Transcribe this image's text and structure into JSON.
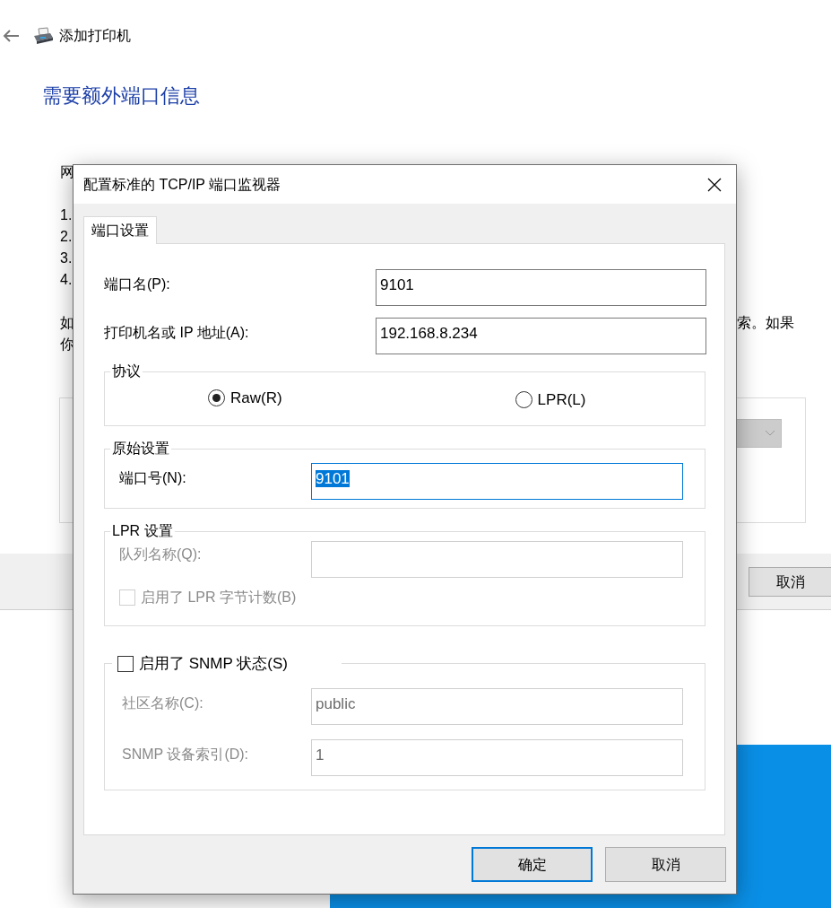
{
  "wizard": {
    "title": "添加打印机",
    "heading": "需要额外端口信息",
    "fragments": [
      "网",
      "1.",
      "2.",
      "3.",
      "4.",
      "如",
      "你"
    ],
    "right_fragment": "索。如果",
    "cancel_button": "取消"
  },
  "dialog": {
    "title": "配置标准的 TCP/IP 端口监视器",
    "tabs": [
      {
        "label": "端口设置",
        "selected": true
      }
    ],
    "fields": [
      {
        "label": "端口名(P):",
        "value": "9101"
      },
      {
        "label": "打印机名或 IP 地址(A):",
        "value": "192.168.8.234"
      }
    ],
    "protocol": {
      "title": "协议",
      "options": [
        {
          "label": "Raw(R)",
          "selected": true
        },
        {
          "label": "LPR(L)",
          "selected": false
        }
      ]
    },
    "raw_settings": {
      "title": "原始设置",
      "label": "端口号(N):",
      "value": "9101",
      "text_selected": true
    },
    "lpr_settings": {
      "title": "LPR 设置",
      "disabled": true,
      "queue_label": "队列名称(Q):",
      "byte_count": {
        "label": "启用了 LPR 字节计数(B)",
        "checked": false
      }
    },
    "snmp": {
      "label": "启用了 SNMP 状态(S)",
      "checked": false,
      "disabled": true,
      "fields": [
        {
          "label": "社区名称(C):",
          "value": "public"
        },
        {
          "label": "SNMP 设备索引(D):",
          "value": "1"
        }
      ]
    },
    "buttons": [
      {
        "label": "确定",
        "default": true
      },
      {
        "label": "取消",
        "default": false
      }
    ]
  }
}
